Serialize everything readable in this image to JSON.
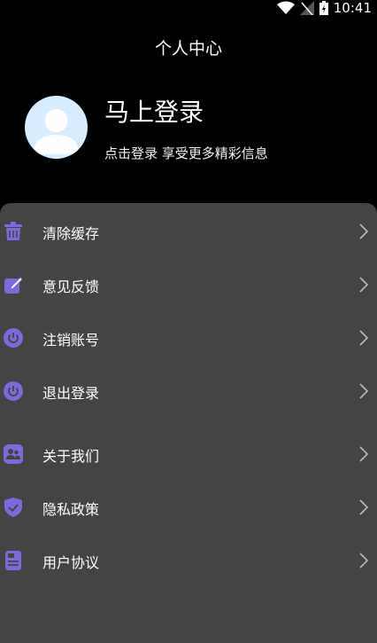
{
  "status": {
    "time": "10:41"
  },
  "header": {
    "title": "个人中心"
  },
  "profile": {
    "login_title": "马上登录",
    "login_subtitle": "点击登录 享受更多精彩信息"
  },
  "menu": [
    {
      "label": "清除缓存",
      "icon": "trash-icon"
    },
    {
      "label": "意见反馈",
      "icon": "edit-icon"
    },
    {
      "label": "注销账号",
      "icon": "power-icon"
    },
    {
      "label": "退出登录",
      "icon": "power-icon"
    },
    {
      "label": "关于我们",
      "icon": "people-icon"
    },
    {
      "label": "隐私政策",
      "icon": "shield-icon"
    },
    {
      "label": "用户协议",
      "icon": "document-icon"
    }
  ],
  "colors": {
    "accent": "#7a6bdc",
    "panel": "#444444",
    "background": "#000000"
  }
}
